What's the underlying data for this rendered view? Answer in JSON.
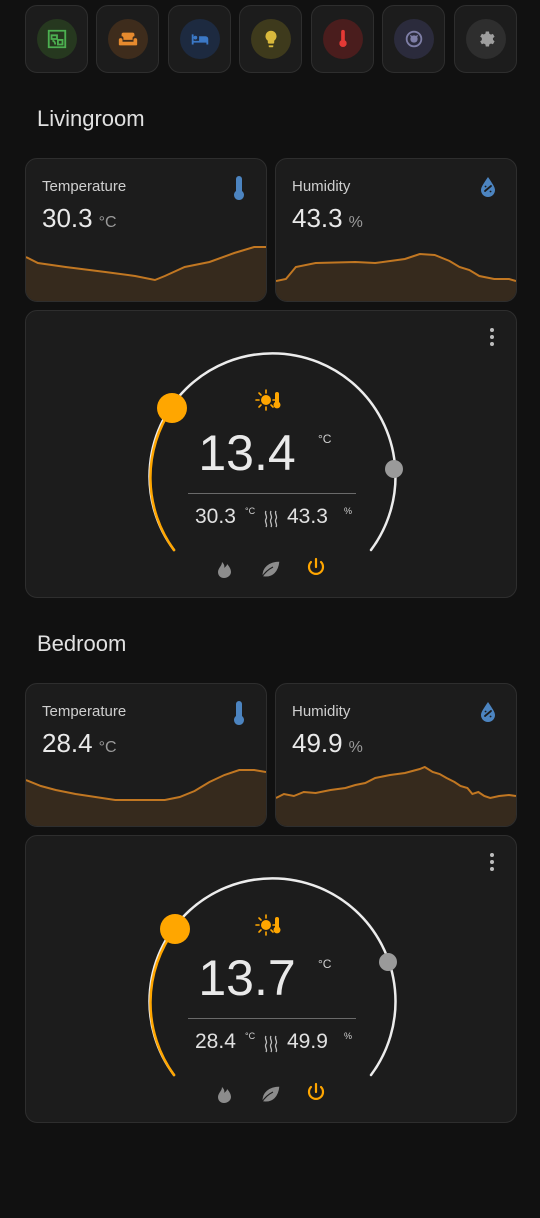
{
  "nav": [
    {
      "name": "garden",
      "bg": "#26381f",
      "color": "#4caf50"
    },
    {
      "name": "sofa",
      "bg": "#3e2c1c",
      "color": "#e68a2e"
    },
    {
      "name": "bed",
      "bg": "#1d2a40",
      "color": "#3b78c6"
    },
    {
      "name": "lightbulb",
      "bg": "#3e3a1c",
      "color": "#d9b93c"
    },
    {
      "name": "thermometer",
      "bg": "#4a1d1d",
      "color": "#e53935"
    },
    {
      "name": "robot-vacuum",
      "bg": "#2b2b3c",
      "color": "#7e7ea6"
    },
    {
      "name": "gear",
      "bg": "#2e2e2e",
      "color": "#9e9e9e"
    }
  ],
  "colors": {
    "accent": "#ffa600",
    "sensor_icon": "#4c84c0",
    "chart_line": "#c17722",
    "chart_fill": "#362a1d"
  },
  "rooms": [
    {
      "title": "Livingroom",
      "temperature": {
        "label": "Temperature",
        "value": "30.3",
        "unit": "°C"
      },
      "humidity": {
        "label": "Humidity",
        "value": "43.3",
        "unit": "%"
      },
      "thermostat": {
        "target": "13.4",
        "target_unit": "°C",
        "current_temp": "30.3",
        "current_temp_unit": "°C",
        "current_hum": "43.3",
        "current_hum_unit": "%",
        "level": 0.1
      }
    },
    {
      "title": "Bedroom",
      "temperature": {
        "label": "Temperature",
        "value": "28.4",
        "unit": "°C"
      },
      "humidity": {
        "label": "Humidity",
        "value": "49.9",
        "unit": "%"
      },
      "thermostat": {
        "target": "13.7",
        "target_unit": "°C",
        "current_temp": "28.4",
        "current_temp_unit": "°C",
        "current_hum": "49.9",
        "current_hum_unit": "%",
        "level": 0.12
      }
    }
  ]
}
